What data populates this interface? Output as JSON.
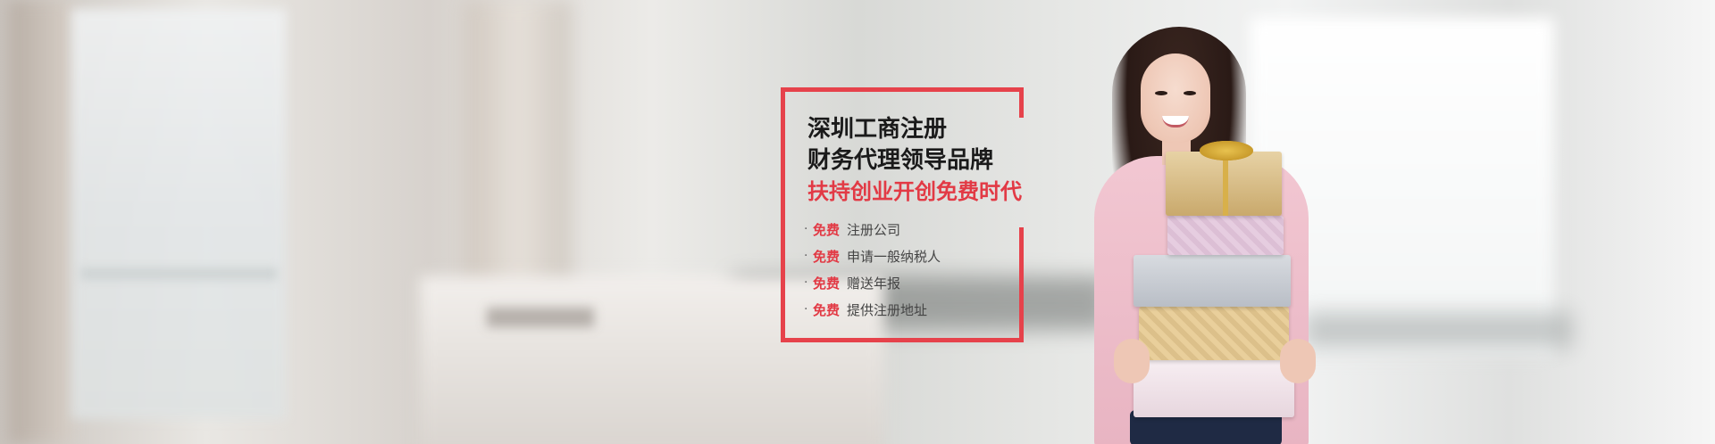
{
  "promo": {
    "headline_line1": "深圳工商注册",
    "headline_line2": "财务代理领导品牌",
    "headline_line3": "扶持创业开创免费时代",
    "bullet": "·",
    "benefits": [
      {
        "tag": "免费",
        "text": "注册公司"
      },
      {
        "tag": "免费",
        "text": "申请一般纳税人"
      },
      {
        "tag": "免费",
        "text": "赠送年报"
      },
      {
        "tag": "免费",
        "text": "提供注册地址"
      }
    ]
  },
  "colors": {
    "accent_red": "#e6424b",
    "headline_dark": "#1a1a1a",
    "text_gray": "#444444"
  }
}
